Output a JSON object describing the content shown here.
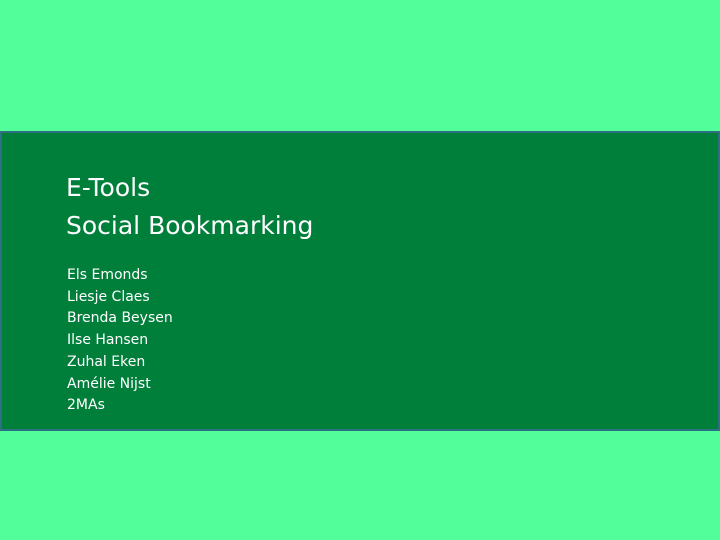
{
  "slide": {
    "title_lines": [
      "E-Tools",
      "Social Bookmarking"
    ],
    "authors": [
      "Els Emonds",
      "Liesje Claes",
      "Brenda Beysen",
      "Ilse Hansen",
      "Zuhal Eken",
      "Amélie Nijst",
      "2MAs"
    ],
    "colors": {
      "background": "#52fe9a",
      "band": "#007f3b",
      "band_border": "#2f6f82",
      "text": "#ffffff"
    }
  }
}
